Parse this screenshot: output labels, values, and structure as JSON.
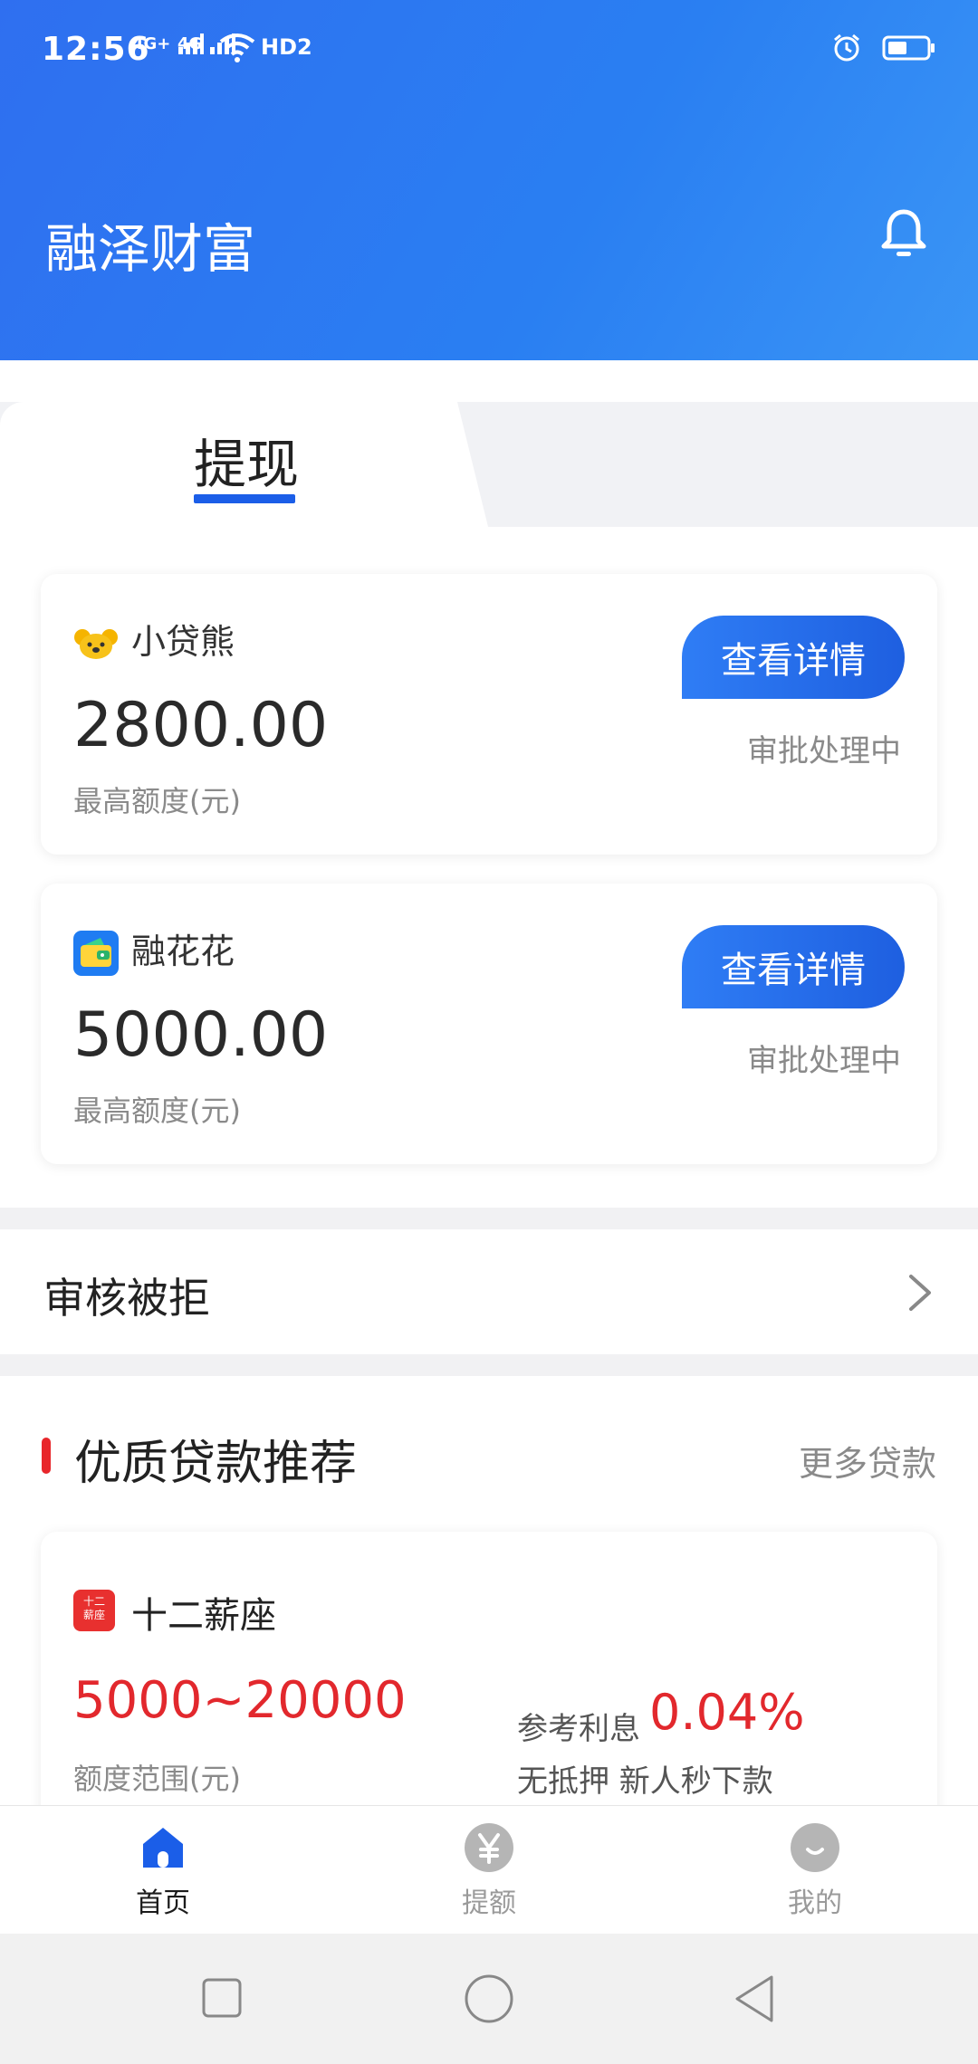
{
  "status_bar": {
    "time": "12:56",
    "signal1": "4G+",
    "signal2": "4G",
    "hd_label": "HD2"
  },
  "header": {
    "title": "融泽财富",
    "bell_icon": "bell-icon"
  },
  "tabs": {
    "active_label": "提现"
  },
  "loan_cards": [
    {
      "name": "小贷熊",
      "amount": "2800.00",
      "sub_label": "最高额度(元)",
      "button_label": "查看详情",
      "status": "审批处理中",
      "logo_icon": "koala-icon"
    },
    {
      "name": "融花花",
      "amount": "5000.00",
      "sub_label": "最高额度(元)",
      "button_label": "查看详情",
      "status": "审批处理中",
      "logo_icon": "wallet-icon"
    }
  ],
  "rejected": {
    "label": "审核被拒"
  },
  "recommend": {
    "title": "优质贷款推荐",
    "more_label": "更多贷款",
    "card": {
      "name": "十二薪座",
      "logo_text_line1": "十二",
      "logo_text_line2": "薪座",
      "range": "5000~20000",
      "range_label": "额度范围(元)",
      "rate_label": "参考利息",
      "rate": "0.04%",
      "description": "无抵押 新人秒下款"
    }
  },
  "bottom_nav": [
    {
      "label": "首页",
      "icon": "home-icon",
      "active": true
    },
    {
      "label": "提额",
      "icon": "yen-icon",
      "active": false
    },
    {
      "label": "我的",
      "icon": "smile-icon",
      "active": false
    }
  ],
  "colors": {
    "header_blue": "#2f6ff0",
    "accent_blue": "#1e5fe0",
    "accent_red": "#e2282d",
    "nav_active": "#1b5ee8",
    "nav_inactive": "#9a9a9a"
  }
}
